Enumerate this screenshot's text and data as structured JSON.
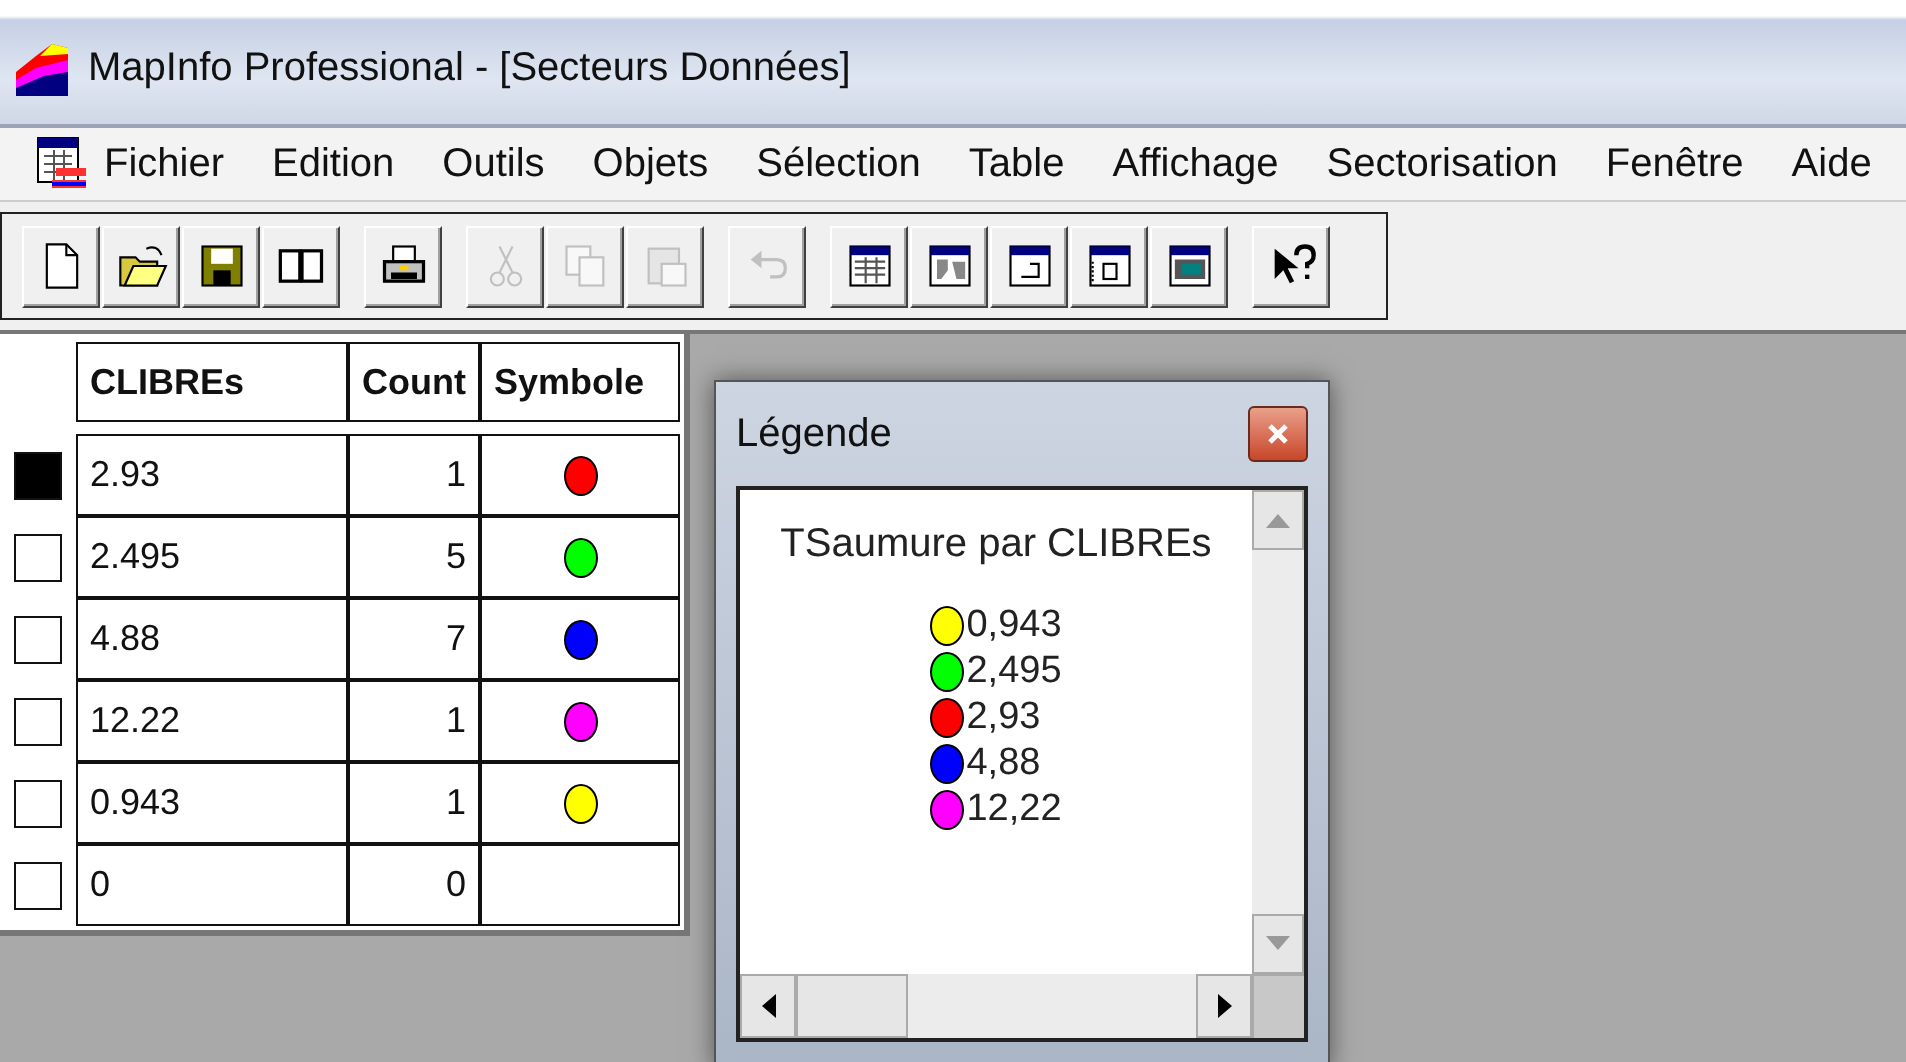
{
  "window": {
    "title": "MapInfo Professional - [Secteurs Données]"
  },
  "menu": [
    "Fichier",
    "Edition",
    "Outils",
    "Objets",
    "Sélection",
    "Table",
    "Affichage",
    "Sectorisation",
    "Fenêtre",
    "Aide"
  ],
  "toolbar": [
    [
      {
        "kind": "new",
        "disabled": false
      },
      {
        "kind": "open",
        "disabled": false
      },
      {
        "kind": "save",
        "disabled": false
      },
      {
        "kind": "book",
        "disabled": false
      }
    ],
    [
      {
        "kind": "print",
        "disabled": false
      }
    ],
    [
      {
        "kind": "cut",
        "disabled": true
      },
      {
        "kind": "copy",
        "disabled": true
      },
      {
        "kind": "paste",
        "disabled": true
      }
    ],
    [
      {
        "kind": "undo",
        "disabled": true
      }
    ],
    [
      {
        "kind": "browser",
        "disabled": false
      },
      {
        "kind": "map",
        "disabled": false
      },
      {
        "kind": "graph",
        "disabled": false
      },
      {
        "kind": "layout",
        "disabled": false
      },
      {
        "kind": "redistrict",
        "disabled": false
      }
    ],
    [
      {
        "kind": "help",
        "disabled": false
      }
    ]
  ],
  "table": {
    "columns": [
      "CLIBREs",
      "Count",
      "Symbole"
    ],
    "rows": [
      {
        "selected": true,
        "value": "2.93",
        "count": "1",
        "color": "#ff0000"
      },
      {
        "selected": false,
        "value": "2.495",
        "count": "5",
        "color": "#00ff00"
      },
      {
        "selected": false,
        "value": "4.88",
        "count": "7",
        "color": "#0000ff"
      },
      {
        "selected": false,
        "value": "12.22",
        "count": "1",
        "color": "#ff00ff"
      },
      {
        "selected": false,
        "value": "0.943",
        "count": "1",
        "color": "#ffff00"
      },
      {
        "selected": false,
        "value": "0",
        "count": "0"
      }
    ]
  },
  "legend": {
    "title": "Légende",
    "heading": "TSaumure par CLIBREs",
    "items": [
      {
        "label": "0,943",
        "color": "#ffff00"
      },
      {
        "label": "2,495",
        "color": "#00ff00"
      },
      {
        "label": "2,93",
        "color": "#ff0000"
      },
      {
        "label": "4,88",
        "color": "#0000ff"
      },
      {
        "label": "12,22",
        "color": "#ff00ff"
      }
    ]
  }
}
